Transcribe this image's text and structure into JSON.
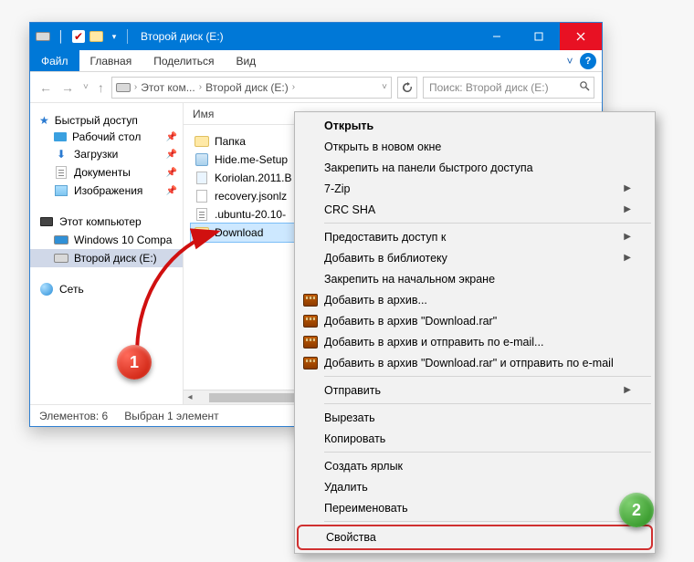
{
  "window": {
    "title": "Второй диск (E:)"
  },
  "ribbon": {
    "file": "Файл",
    "home": "Главная",
    "share": "Поделиться",
    "view": "Вид"
  },
  "address": {
    "crumb1": "Этот ком...",
    "crumb2": "Второй диск (E:)",
    "search_placeholder": "Поиск: Второй диск (E:)"
  },
  "nav": {
    "quick": "Быстрый доступ",
    "desktop": "Рабочий стол",
    "downloads": "Загрузки",
    "documents": "Документы",
    "pictures": "Изображения",
    "thispc": "Этот компьютер",
    "win10": "Windows 10 Compa",
    "drive": "Второй диск (E:)",
    "network": "Сеть"
  },
  "column": {
    "name": "Имя"
  },
  "files": {
    "f0": "Папка",
    "f1": "Hide.me-Setup",
    "f2": "Koriolan.2011.B",
    "f3": "recovery.jsonlz",
    "f4": ".ubuntu-20.10-",
    "f5": "Download"
  },
  "status": {
    "count": "Элементов: 6",
    "sel": "Выбран 1 элемент"
  },
  "ctx": {
    "open": "Открыть",
    "open_new": "Открыть в новом окне",
    "pin_quick": "Закрепить на панели быстрого доступа",
    "seven_zip": "7-Zip",
    "crc_sha": "CRC SHA",
    "grant": "Предоставить доступ к",
    "add_lib": "Добавить в библиотеку",
    "pin_start": "Закрепить на начальном экране",
    "rar_add": "Добавить в архив...",
    "rar_add_name": "Добавить в архив \"Download.rar\"",
    "rar_mail": "Добавить в архив и отправить по e-mail...",
    "rar_mail_name": "Добавить в архив \"Download.rar\" и отправить по e-mail",
    "send": "Отправить",
    "cut": "Вырезать",
    "copy": "Копировать",
    "shortcut": "Создать ярлык",
    "delete": "Удалить",
    "rename": "Переименовать",
    "props": "Свойства"
  },
  "badges": {
    "one": "1",
    "two": "2"
  }
}
